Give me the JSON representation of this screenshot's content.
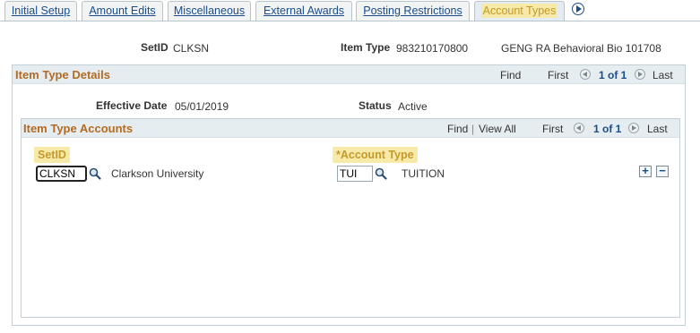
{
  "tabs": [
    {
      "label": "Initial Setup",
      "active": false
    },
    {
      "label": "Amount Edits",
      "active": false
    },
    {
      "label": "Miscellaneous",
      "active": false
    },
    {
      "label": "External Awards",
      "active": false
    },
    {
      "label": "Posting Restrictions",
      "active": false
    },
    {
      "label": "Account Types",
      "active": true
    }
  ],
  "header": {
    "setid_label": "SetID",
    "setid_value": "CLKSN",
    "item_type_label": "Item Type",
    "item_type_value": "983210170800",
    "item_type_desc": "GENG RA Behavioral Bio 101708"
  },
  "item_type_details": {
    "title": "Item Type Details",
    "find": "Find",
    "first": "First",
    "count": "1 of 1",
    "last": "Last",
    "effective_date_label": "Effective Date",
    "effective_date_value": "05/01/2019",
    "status_label": "Status",
    "status_value": "Active"
  },
  "item_type_accounts": {
    "title": "Item Type Accounts",
    "find": "Find",
    "separator": "|",
    "view_all": "View All",
    "first": "First",
    "count": "1 of 1",
    "last": "Last",
    "setid_col": "SetID",
    "account_type_col": "*Account Type",
    "row": {
      "setid": "CLKSN",
      "setid_desc": "Clarkson University",
      "account_type": "TUI",
      "account_type_desc": "TUITION"
    },
    "add_label": "+",
    "delete_label": "−"
  },
  "colors": {
    "section_title": "#b26b22",
    "link": "#1a4c8a",
    "highlight": "#f7e9a8"
  }
}
